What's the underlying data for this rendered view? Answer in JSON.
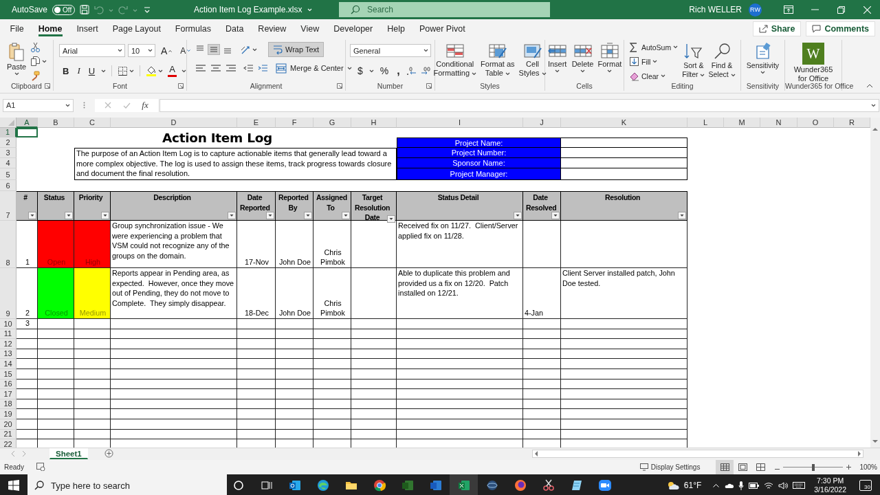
{
  "title_bar": {
    "autosave_label": "AutoSave",
    "autosave": {
      "label": "Off",
      "on": false
    },
    "quick_access": [
      {
        "kind": "save",
        "disabled": false
      },
      {
        "kind": "undo",
        "disabled": true
      },
      {
        "kind": "redo",
        "disabled": true
      },
      {
        "kind": "customize",
        "disabled": false
      }
    ],
    "file_name": "Action Item Log Example.xlsx",
    "search": {
      "placeholder": "Search"
    },
    "user": {
      "name": "Rich WELLER",
      "initials": "RW"
    }
  },
  "ribbon_tabs": [
    {
      "label": "File",
      "selected": false
    },
    {
      "label": "Home",
      "selected": true
    },
    {
      "label": "Insert",
      "selected": false
    },
    {
      "label": "Page Layout",
      "selected": false
    },
    {
      "label": "Formulas",
      "selected": false
    },
    {
      "label": "Data",
      "selected": false
    },
    {
      "label": "Review",
      "selected": false
    },
    {
      "label": "View",
      "selected": false
    },
    {
      "label": "Developer",
      "selected": false
    },
    {
      "label": "Help",
      "selected": false
    },
    {
      "label": "Power Pivot",
      "selected": false
    }
  ],
  "share": "Share",
  "comments": "Comments",
  "ribbon": {
    "clipboard": {
      "label": "Clipboard",
      "paste": "Paste"
    },
    "font": {
      "label": "Font",
      "font_name": "Arial",
      "font_size": "10",
      "grow": "A",
      "shrink": "A",
      "bold": "B",
      "italic": "I",
      "underline": "U",
      "font_color": "A"
    },
    "alignment": {
      "label": "Alignment",
      "vertical_align": [
        {
          "selected": false
        },
        {
          "selected": true
        },
        {
          "selected": false
        }
      ],
      "horizontal_align": [
        {
          "selected": false
        },
        {
          "selected": false
        },
        {
          "selected": false
        }
      ],
      "wrap_text": {
        "label": "Wrap Text",
        "pressed": true
      },
      "merge": "Merge & Center"
    },
    "number": {
      "label": "Number",
      "format": "General",
      "currency": "$",
      "percent": "%",
      "comma": ","
    },
    "styles": {
      "label": "Styles",
      "buttons": [
        "Conditional\nFormatting",
        "Format as\nTable",
        "Cell\nStyles"
      ]
    },
    "cells": {
      "label": "Cells",
      "buttons": [
        "Insert",
        "Delete",
        "Format"
      ]
    },
    "editing": {
      "label": "Editing",
      "small": [
        "AutoSum",
        "Fill",
        "Clear"
      ],
      "buttons": [
        "Sort &\nFilter",
        "Find &\nSelect"
      ]
    },
    "sensitivity": {
      "label": "Sensitivity",
      "button": "Sensitivity"
    },
    "addin": {
      "label": "Wunder365 for Office",
      "logo": "W",
      "button": "Wunder365\nfor Office"
    }
  },
  "formula_bar": {
    "name_box": "A1",
    "function_label": "fx"
  },
  "sheet": {
    "columns": [
      {
        "label": "A",
        "selected": true
      },
      {
        "label": "B",
        "selected": false
      },
      {
        "label": "C",
        "selected": false
      },
      {
        "label": "D",
        "selected": false
      },
      {
        "label": "E",
        "selected": false
      },
      {
        "label": "F",
        "selected": false
      },
      {
        "label": "G",
        "selected": false
      },
      {
        "label": "H",
        "selected": false
      },
      {
        "label": "I",
        "selected": false
      },
      {
        "label": "J",
        "selected": false
      },
      {
        "label": "K",
        "selected": false
      },
      {
        "label": "L",
        "selected": false
      },
      {
        "label": "M",
        "selected": false
      },
      {
        "label": "N",
        "selected": false
      },
      {
        "label": "O",
        "selected": false
      },
      {
        "label": "R",
        "selected": false
      }
    ],
    "rows": [
      {
        "label": "1",
        "selected": true
      },
      {
        "label": "2",
        "selected": false
      },
      {
        "label": "3",
        "selected": false
      },
      {
        "label": "4",
        "selected": false
      },
      {
        "label": "5",
        "selected": false
      },
      {
        "label": "6",
        "selected": false
      },
      {
        "label": "7",
        "selected": false
      },
      {
        "label": "8",
        "selected": false
      },
      {
        "label": "9",
        "selected": false
      },
      {
        "label": "10",
        "selected": false
      },
      {
        "label": "11",
        "selected": false
      },
      {
        "label": "12",
        "selected": false
      },
      {
        "label": "13",
        "selected": false
      },
      {
        "label": "14",
        "selected": false
      },
      {
        "label": "15",
        "selected": false
      },
      {
        "label": "16",
        "selected": false
      },
      {
        "label": "17",
        "selected": false
      },
      {
        "label": "18",
        "selected": false
      },
      {
        "label": "19",
        "selected": false
      },
      {
        "label": "20",
        "selected": false
      },
      {
        "label": "21",
        "selected": false
      },
      {
        "label": "22",
        "selected": false
      }
    ],
    "title": "Action Item Log",
    "description": "The purpose of an Action Item Log is to capture actionable items that generally lead toward a more complex objective. The log is used to assign these items, track progress towards closure and document the final resolution.",
    "project_fields": [
      "Project Name:",
      "Project Number:",
      "Sponsor Name:",
      "Project Manager:"
    ],
    "table": {
      "columns": [
        "#",
        "Status",
        "Priority",
        "Description",
        "Date\nReported",
        "Reported\nBy",
        "Assigned\nTo",
        "Target\nResolution\nDate",
        "Status Detail",
        "Date\nResolved",
        "Resolution"
      ],
      "rows": [
        {
          "number": "1",
          "status": {
            "text": "Open",
            "color": "#ff0000"
          },
          "priority": {
            "text": "High",
            "color": "#ff0000"
          },
          "description": "Group synchronization issue - We were experiencing a problem that VSM could not recognize any of the groups on the domain.",
          "date_reported": "17-Nov",
          "reported_by": "John Doe",
          "assigned_to": "Chris Pimbok",
          "status_detail": "Received fix on 11/27.  Client/Server applied fix on 11/28."
        },
        {
          "number": "2",
          "status": {
            "text": "Closed",
            "color": "#00ff00"
          },
          "priority": {
            "text": "Medium",
            "color": "#ffff00"
          },
          "description": "Reports appear in Pending area, as expected.  However, once they move out of Pending, they do not move to Complete.  They simply disappear.",
          "date_reported": "18-Dec",
          "reported_by": "John Doe",
          "assigned_to": "Chris Pimbok",
          "status_detail": "Able to duplicate this problem and provided us a fix on 12/20.  Patch installed on 12/21.",
          "date_resolved": "4-Jan",
          "resolution": "Client Server installed patch, John Doe tested."
        },
        {
          "number": "3"
        }
      ]
    }
  },
  "sheet_tabs": [
    {
      "label": "Sheet1",
      "selected": true
    }
  ],
  "status_bar": {
    "status": "Ready",
    "display_settings": "Display Settings",
    "views": [
      {
        "selected": true
      },
      {
        "selected": false
      },
      {
        "selected": false
      }
    ],
    "zoom": {
      "level": 0.5,
      "reading": "100%"
    }
  },
  "taskbar": {
    "search": {
      "placeholder": "Type here to search"
    },
    "apps": [
      {
        "kind": "cortana",
        "selected": false
      },
      {
        "kind": "taskview",
        "selected": false
      },
      {
        "kind": "mail",
        "selected": false
      },
      {
        "kind": "browser",
        "selected": false
      },
      {
        "kind": "folder",
        "selected": false
      },
      {
        "kind": "chrome",
        "selected": false
      },
      {
        "kind": "project",
        "selected": false
      },
      {
        "kind": "word",
        "selected": false
      },
      {
        "kind": "excel",
        "selected": true
      },
      {
        "kind": "globe",
        "selected": false
      },
      {
        "kind": "fox",
        "selected": false
      },
      {
        "kind": "scissors",
        "selected": false
      },
      {
        "kind": "notes",
        "selected": false
      },
      {
        "kind": "camera",
        "selected": false
      }
    ],
    "weather": "61°F",
    "time": "7:30 PM",
    "date": "3/16/2022",
    "notifications": "30"
  }
}
